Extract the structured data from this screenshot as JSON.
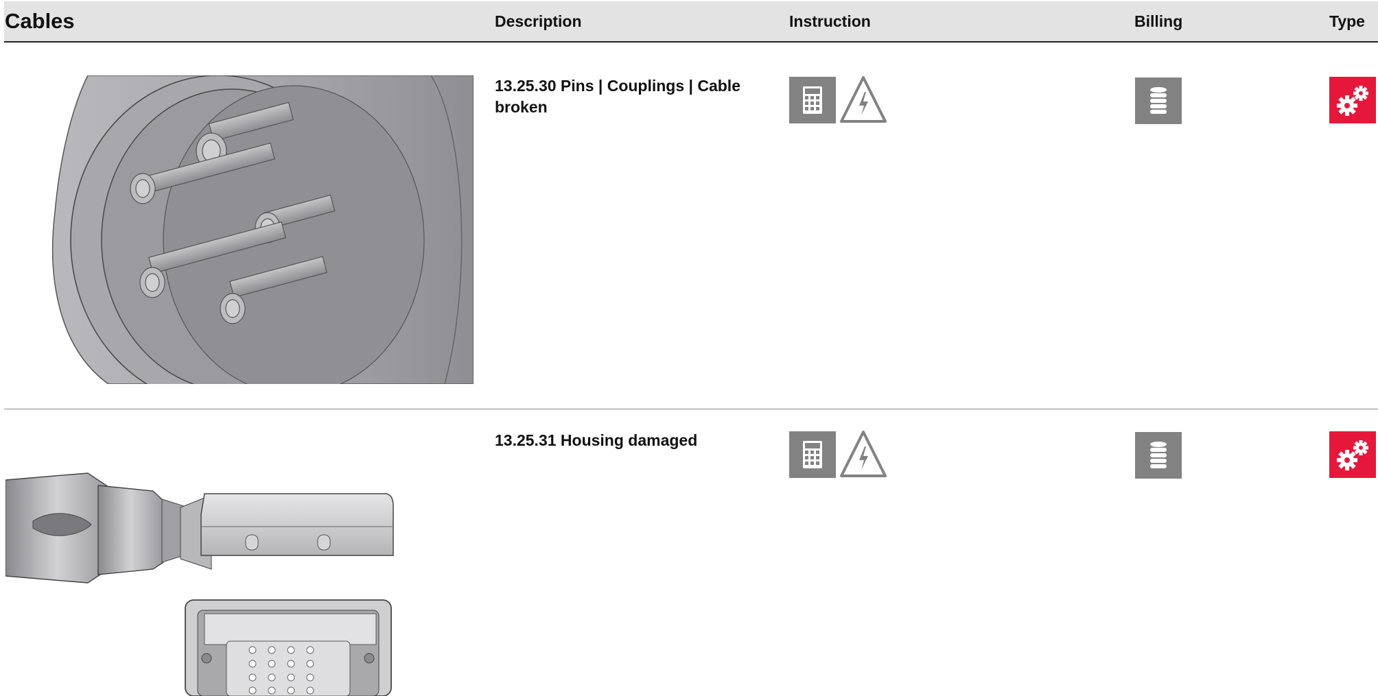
{
  "header": {
    "title": "Cables",
    "columns": {
      "description": "Description",
      "instruction": "Instruction",
      "billing": "Billing",
      "type": "Type"
    }
  },
  "rows": [
    {
      "description": "13.25.30 Pins | Couplings | Cable broken",
      "image": "round-connector-pins-illustration",
      "instruction_icons": [
        "calculator-icon",
        "high-voltage-warning-icon"
      ],
      "billing_icon": "coin-stack-icon",
      "type_icon": "gears-icon"
    },
    {
      "description": "13.25.31 Housing damaged",
      "image": "rectangular-connector-housing-illustration",
      "instruction_icons": [
        "calculator-icon",
        "high-voltage-warning-icon"
      ],
      "billing_icon": "coin-stack-icon",
      "type_icon": "gears-icon"
    }
  ],
  "colors": {
    "header_bg": "#e3e3e3",
    "icon_gray": "#828282",
    "type_red": "#e5183b"
  }
}
